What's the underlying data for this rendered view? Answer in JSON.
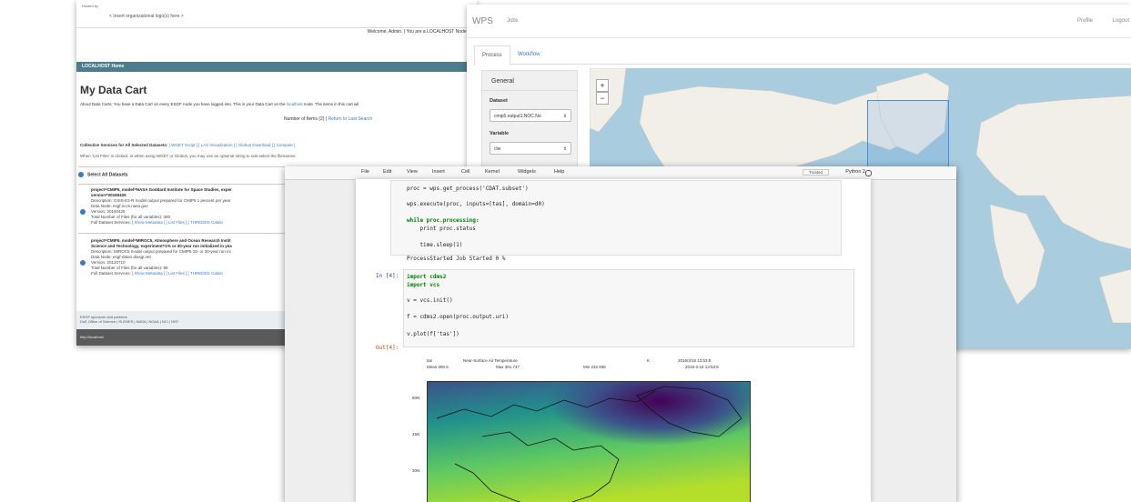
{
  "cart": {
    "hosted_by": "Hosted by",
    "logo_placeholder": "< Insert organizational logo(s) here >",
    "welcome": "Welcome, Admin. | You are a LOCALHOST Node Adm",
    "nav_label": "LOCALHOST Home",
    "title": "My Data Cart",
    "about_prefix": "About Data Carts: You have a Data Cart on every ESGF node you have logged into. This is your Data Cart on the",
    "about_link": "localhost",
    "about_suffix": "node. The items in this cart wil",
    "number_of_items": "Number of Items (2)",
    "return_link": "Return to Last Search",
    "collective_label": "Collective Services for All Selected Datasets:",
    "services": [
      "[ WGET Script ]",
      "[ LAS Visualization ]",
      "[ Globus Download ]",
      "[ Compute ]"
    ],
    "note": "When 'List Files' is clicked, or when using WGET or Globus, you may use an optional string to sub-select the filenames:",
    "select_all": "Select All Datasets",
    "datasets": [
      {
        "id_line1": "project=CMIP5, model=NASA Goddard Institute for Space Studies, exper",
        "id_line2": "version=20160425",
        "description": "Description: GISS-E2-R model output prepared for CMIP5 1 percent per year",
        "node": "Data Node: esgf.nccs.nasa.gov",
        "version": "Version: 20160425",
        "total_files": "Total Number of Files (for all variables): 300",
        "services_prefix": "Full Dataset Services:",
        "links": "[ Show Metadata ]   [ List Files ]   [ THREDDS Catalo"
      },
      {
        "id_line1": "project=CMIP5, model=MIROC5, Atmosphere and Ocean Research Instit",
        "id_line2": "Science and Technology, experiment=1% or 30-year run initialized in yea",
        "description": "Description: MIROC5 model output prepared for CMIP5 10- or 30-year run ini",
        "node": "Data Node: esgf-data1.diasjp.net",
        "version": "Version: 20120710",
        "total_files": "Total Number of Files (for all variables): 98",
        "services_prefix": "Full Dataset Services:",
        "links": "[ Show Metadata ]   [ List Files ]   [ THREDDS Catalo"
      }
    ],
    "footer_line1": "ESGF sponsors and partners",
    "footer_line2": "DoE Office of Science | IS-ENES | NASA | NOAA | NCI | NSF",
    "status_url": "http://localhost"
  },
  "wps": {
    "brand": "WPS",
    "nav_jobs": "Jobs",
    "profile": "Profile",
    "logout": "Logout",
    "tabs": [
      "Process",
      "Workflow"
    ],
    "panel_title": "General",
    "dataset_label": "Dataset",
    "dataset_value": "cmip5.output1.NOC.No",
    "variable_label": "Variable",
    "variable_value": "clw",
    "zoom_in": "+",
    "zoom_out": "−"
  },
  "jupyter": {
    "menu": [
      "File",
      "Edit",
      "View",
      "Insert",
      "Cell",
      "Kernel",
      "Widgets",
      "Help"
    ],
    "trusted": "Trusted",
    "kernel": "Python 2",
    "cell1_lines": [
      "proc = wps.get_process('CDAT.subset')",
      "wps.execute(proc, inputs=[tas], domain=d0)",
      "while proc.processing:",
      "    print proc.status",
      "    time.sleep(1)"
    ],
    "cell1_output": "ProcessStarted Job Started 0 %",
    "cell2_prompt": "In [4]:",
    "cell2_lines": [
      "import cdms2",
      "import vcs",
      "v = vcs.init()",
      "f = cdms2.open(proc.output.uri)",
      "v.plot(f['tas'])"
    ],
    "out_prompt": "Out[4]:",
    "plot_header": {
      "var": "tas",
      "long_name": "Near-Surface Air Temperature",
      "units": "K",
      "date": "2016/3/16   13:53:8",
      "date2": "2016-3-16 13:53:8",
      "mean": "Mean 280.5",
      "max": "Max 301.747",
      "min": "Min 232.936"
    },
    "y_ticks": [
      "60N",
      "45N",
      "30N"
    ]
  }
}
